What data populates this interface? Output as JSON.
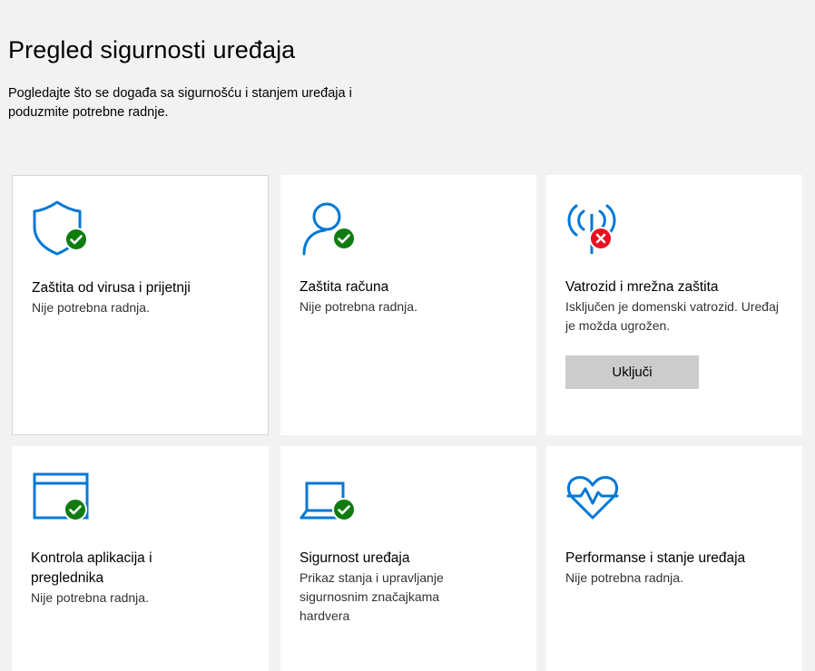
{
  "page": {
    "title": "Pregled sigurnosti uređaja",
    "description": "Pogledajte što se događa sa sigurnošću i stanjem uređaja i poduzmite potrebne radnje."
  },
  "colors": {
    "accent": "#0078d7",
    "ok": "#107c10",
    "error": "#e81123",
    "button_bg": "#cccccc"
  },
  "cards": [
    {
      "title": "Zaštita od virusa i prijetnji",
      "status": "Nije potrebna radnja.",
      "icon": "shield-icon",
      "badge": "ok"
    },
    {
      "title": "Zaštita računa",
      "status": "Nije potrebna radnja.",
      "icon": "account-icon",
      "badge": "ok"
    },
    {
      "title": "Vatrozid i mrežna zaštita",
      "status": "Isključen je domenski vatrozid. Uređaj je možda ugrožen.",
      "icon": "firewall-antenna-icon",
      "badge": "error",
      "action_label": "Uključi"
    },
    {
      "title": "Kontrola aplikacija i preglednika",
      "status": "Nije potrebna radnja.",
      "icon": "app-browser-icon",
      "badge": "ok"
    },
    {
      "title": "Sigurnost uređaja",
      "status": "Prikaz stanja i upravljanje sigurnosnim značajkama hardvera",
      "icon": "laptop-icon",
      "badge": "ok"
    },
    {
      "title": "Performanse i stanje uređaja",
      "status": "Nije potrebna radnja.",
      "icon": "heart-pulse-icon",
      "badge": "none"
    }
  ]
}
